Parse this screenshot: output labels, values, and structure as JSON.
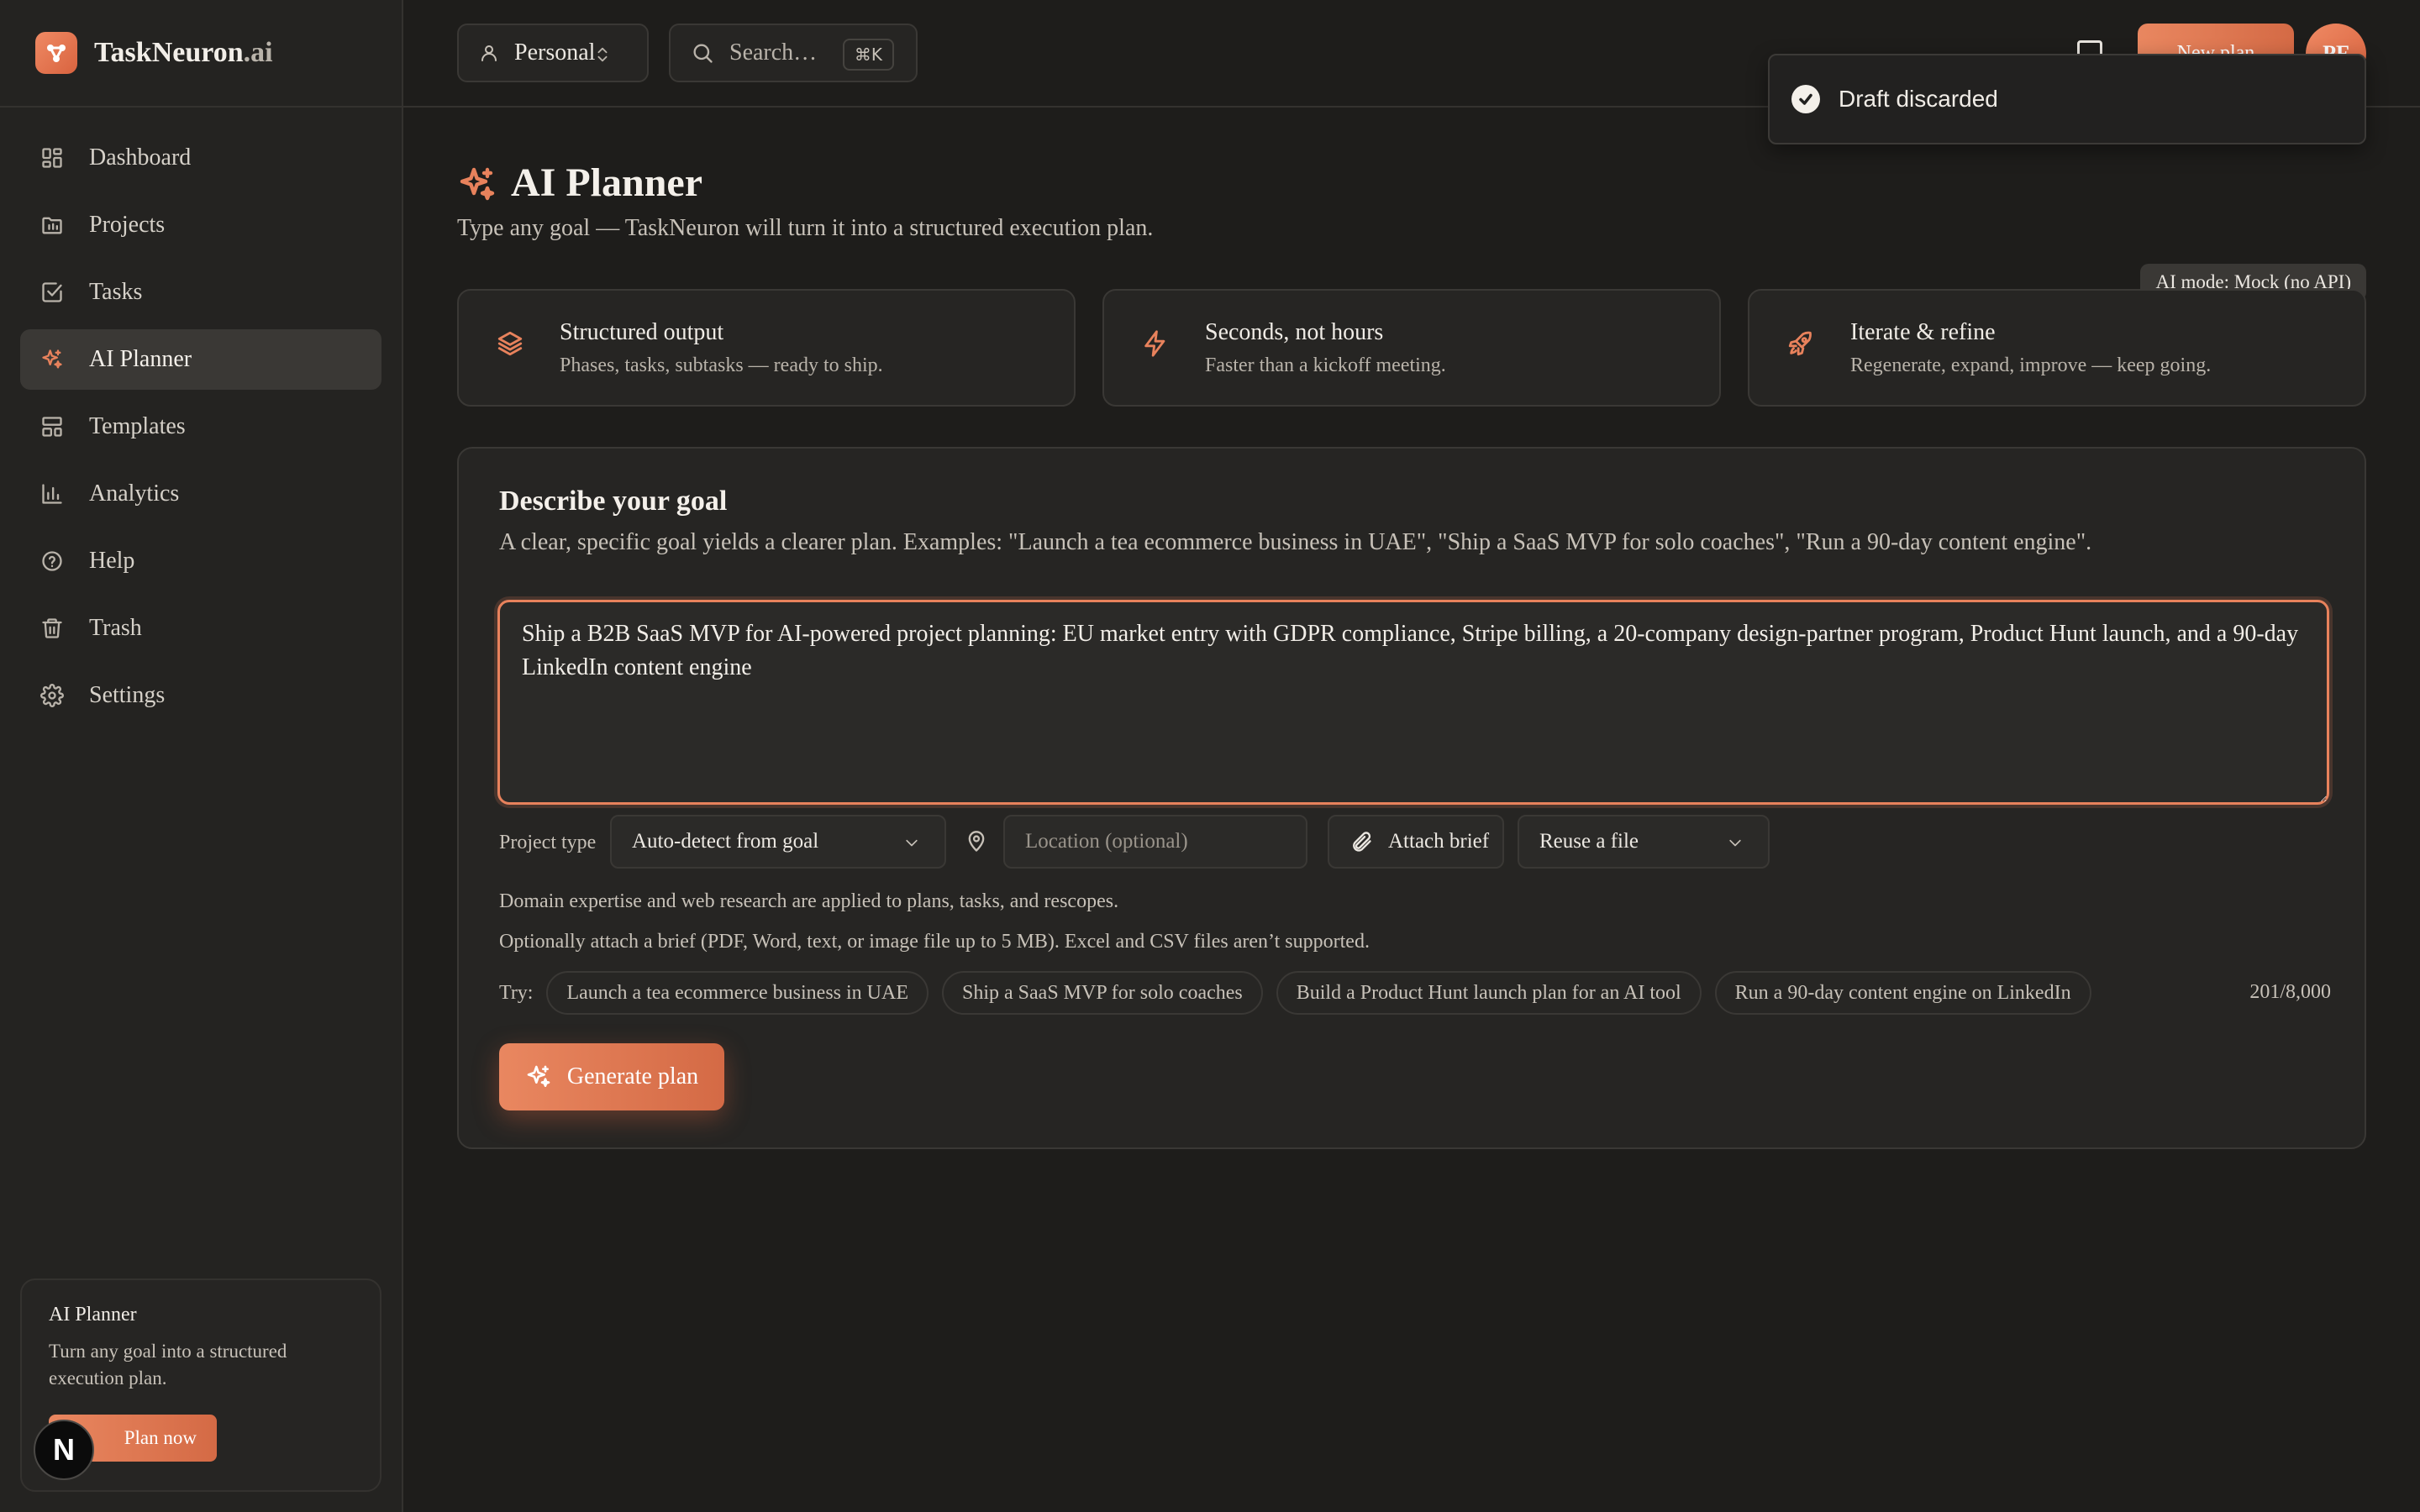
{
  "brand": {
    "name": "TaskNeuron",
    "suffix": ".ai"
  },
  "nav": [
    {
      "label": "Dashboard",
      "icon": "dashboard-icon"
    },
    {
      "label": "Projects",
      "icon": "folder-icon"
    },
    {
      "label": "Tasks",
      "icon": "checkbox-icon"
    },
    {
      "label": "AI Planner",
      "icon": "sparkles-icon",
      "active": true
    },
    {
      "label": "Templates",
      "icon": "template-icon"
    },
    {
      "label": "Analytics",
      "icon": "bar-chart-icon"
    },
    {
      "label": "Help",
      "icon": "help-circle-icon"
    },
    {
      "label": "Trash",
      "icon": "trash-icon"
    },
    {
      "label": "Settings",
      "icon": "gear-icon"
    }
  ],
  "promo": {
    "title": "AI Planner",
    "text": "Turn any goal into a structured execution plan.",
    "button": "Plan now"
  },
  "n_badge": "N",
  "topbar": {
    "workspace": "Personal",
    "search_placeholder": "Search…",
    "search_shortcut": "⌘K",
    "new_plan": "New plan",
    "avatar_initials": "PF"
  },
  "toast": {
    "message": "Draft discarded"
  },
  "header": {
    "title": "AI Planner",
    "subtitle": "Type any goal — TaskNeuron will turn it into a structured execution plan.",
    "ai_mode": "AI mode: Mock (no API)"
  },
  "features": [
    {
      "title": "Structured output",
      "desc": "Phases, tasks, subtasks — ready to ship.",
      "icon": "layers-icon"
    },
    {
      "title": "Seconds, not hours",
      "desc": "Faster than a kickoff meeting.",
      "icon": "lightning-icon"
    },
    {
      "title": "Iterate & refine",
      "desc": "Regenerate, expand, improve — keep going.",
      "icon": "rocket-icon"
    }
  ],
  "goal": {
    "title": "Describe your goal",
    "hint": "A clear, specific goal yields a clearer plan. Examples: \"Launch a tea ecommerce business in UAE\", \"Ship a SaaS MVP for solo coaches\", \"Run a 90-day content engine\".",
    "value": "Ship a B2B SaaS MVP for AI-powered project planning: EU market entry with GDPR compliance, Stripe billing, a 20-company design-partner program, Product Hunt launch, and a 90-day LinkedIn content engine",
    "project_type_label": "Project type",
    "project_type_value": "Auto-detect from goal",
    "location_placeholder": "Location (optional)",
    "attach_label": "Attach brief",
    "reuse_label": "Reuse a file",
    "note1": "Domain expertise and web research are applied to plans, tasks, and rescopes.",
    "note2": "Optionally attach a brief (PDF, Word, text, or image file up to 5 MB). Excel and CSV files aren’t supported.",
    "try_label": "Try:",
    "suggestions": [
      "Launch a tea ecommerce business in UAE",
      "Ship a SaaS MVP for solo coaches",
      "Build a Product Hunt launch plan for an AI tool",
      "Run a 90-day content engine on LinkedIn"
    ],
    "char_count": "201/8,000",
    "generate_label": "Generate plan"
  },
  "colors": {
    "accent": "#e8825c",
    "background": "#1e1d1b",
    "sidebar": "#242321",
    "card": "#262523"
  }
}
